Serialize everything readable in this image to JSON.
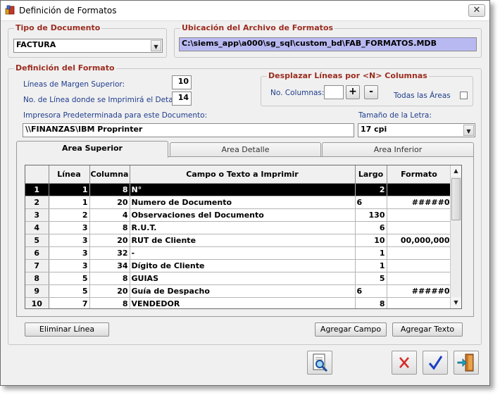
{
  "window": {
    "title": "Definición de Formatos",
    "close_glyph": "✕"
  },
  "tipo_documento": {
    "title": "Tipo de Documento",
    "value": "FACTURA"
  },
  "ubicacion": {
    "title": "Ubicación del Archivo de Formatos",
    "path": "C:\\siems_app\\a000\\sg_sql\\custom_bd\\FAB_FORMATOS.MDB"
  },
  "definicion": {
    "title": "Definición del Formato",
    "margen_label": "Líneas de Margen Superior:",
    "margen_value": "10",
    "linea_detalle_label": "No. de Línea donde se Imprimirá el Detalle:",
    "linea_detalle_value": "14",
    "impresora_label": "Impresora Predeterminada para este Documento:",
    "impresora_value": "\\\\FINANZAS\\IBM Proprinter",
    "tamano_label": "Tamaño de la Letra:",
    "tamano_value": "17 cpi"
  },
  "desplazar": {
    "title": "Desplazar Líneas por <N> Columnas",
    "columnas_label": "No. Columnas:",
    "columnas_value": "",
    "plus": "+",
    "minus": "-",
    "todas_label": "Todas las Áreas"
  },
  "tabs": [
    {
      "label": "Area Superior"
    },
    {
      "label": "Area Detalle"
    },
    {
      "label": "Area Inferior"
    }
  ],
  "grid": {
    "headers": [
      "Línea",
      "Columna",
      "Campo o Texto a Imprimir",
      "Largo",
      "Formato"
    ],
    "rows": [
      {
        "n": "1",
        "linea": "1",
        "columna": "8",
        "campo": "N°",
        "largo": "2",
        "formato": ""
      },
      {
        "n": "2",
        "linea": "1",
        "columna": "20",
        "campo": "Numero de Documento",
        "largo": "6",
        "formato": "#####0"
      },
      {
        "n": "3",
        "linea": "2",
        "columna": "4",
        "campo": "Observaciones del Documento",
        "largo": "130",
        "formato": ""
      },
      {
        "n": "4",
        "linea": "3",
        "columna": "8",
        "campo": "R.U.T.",
        "largo": "6",
        "formato": ""
      },
      {
        "n": "5",
        "linea": "3",
        "columna": "20",
        "campo": "RUT de Cliente",
        "largo": "10",
        "formato": "00,000,000"
      },
      {
        "n": "6",
        "linea": "3",
        "columna": "32",
        "campo": "-",
        "largo": "1",
        "formato": ""
      },
      {
        "n": "7",
        "linea": "3",
        "columna": "34",
        "campo": "Dígito de Cliente",
        "largo": "1",
        "formato": ""
      },
      {
        "n": "8",
        "linea": "5",
        "columna": "8",
        "campo": "GUIAS",
        "largo": "5",
        "formato": ""
      },
      {
        "n": "9",
        "linea": "5",
        "columna": "20",
        "campo": "Guía de Despacho",
        "largo": "6",
        "formato": "#####0"
      },
      {
        "n": "10",
        "linea": "7",
        "columna": "8",
        "campo": "VENDEDOR",
        "largo": "8",
        "formato": ""
      }
    ],
    "selected_row": "1"
  },
  "buttons": {
    "eliminar": "Eliminar Línea",
    "agregar_campo": "Agregar Campo",
    "agregar_texto": "Agregar Texto"
  },
  "colors": {
    "group_title": "#9b2d20",
    "label": "#1e3c8c",
    "path_bg": "#b9b9f2",
    "selected_row": "#000000"
  }
}
